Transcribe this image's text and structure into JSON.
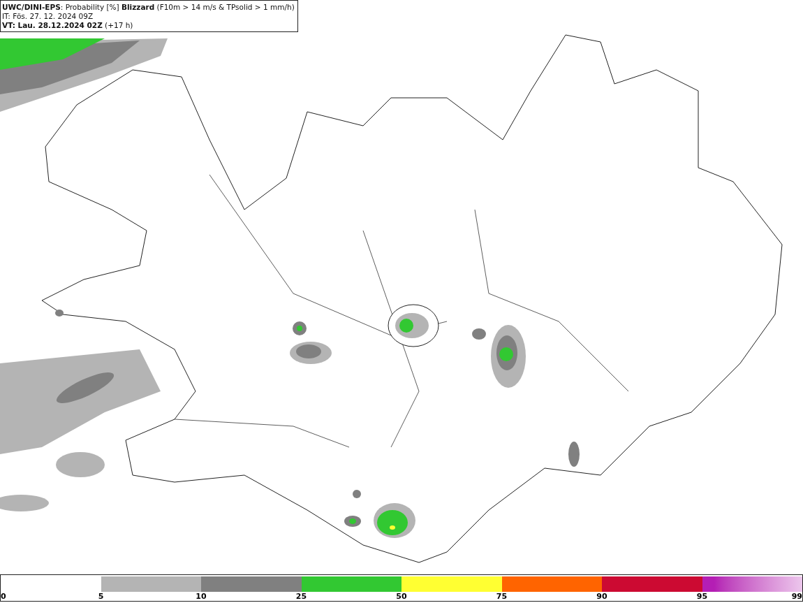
{
  "header": {
    "lines": [
      "**UWC/DINI-EPS**: Probability [%] **Blizzard** (F10m > 14 m/s & TPsolid > 1 mm/h)",
      "IT: Fös. 27. 12. 2024 09Z",
      "**VT: Lau. 28.12.2024 02Z** (+17 h)"
    ]
  },
  "legend": {
    "segments": [
      {
        "color": "#b4b4b4"
      },
      {
        "color": "#808080"
      },
      {
        "color": "#32c832"
      },
      {
        "color": "#ffff32"
      },
      {
        "color": "#ff6400"
      },
      {
        "color": "#cc0a32"
      },
      {
        "color": "#b41eb4",
        "kind": "gradient"
      }
    ],
    "ticks": [
      "0",
      "5",
      "10",
      "25",
      "50",
      "75",
      "90",
      "95",
      "99"
    ]
  }
}
